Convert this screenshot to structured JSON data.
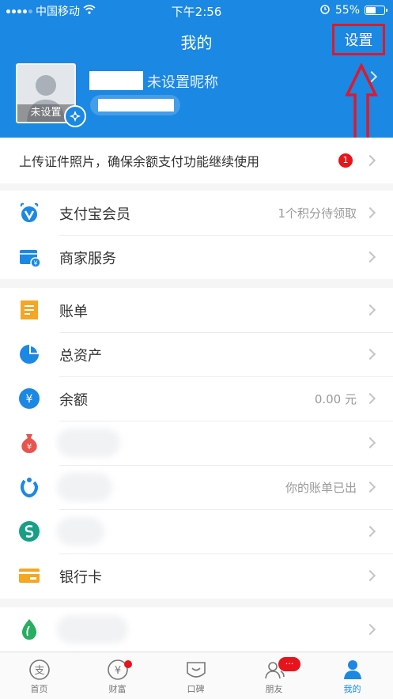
{
  "status_bar": {
    "carrier": "中国移动",
    "time": "下午2:56",
    "battery": "55%",
    "battery_level": 0.55
  },
  "header": {
    "title": "我的",
    "settings_label": "设置",
    "avatar_caption": "未设置",
    "nickname": "未设置昵称"
  },
  "notice": {
    "text": "上传证件照片，确保余额支付功能继续使用",
    "badge": "1"
  },
  "group1": [
    {
      "label": "支付宝会员",
      "value": "1个积分待领取",
      "icon": "member-icon"
    },
    {
      "label": "商家服务",
      "value": "",
      "icon": "merchant-icon"
    }
  ],
  "group2": [
    {
      "label": "账单",
      "value": "",
      "icon": "bill-icon"
    },
    {
      "label": "总资产",
      "value": "",
      "icon": "assets-pie-icon"
    },
    {
      "label": "余额",
      "value": "0.00 元",
      "icon": "yuan-icon"
    },
    {
      "label": "",
      "value": "",
      "icon": "money-bag-icon"
    },
    {
      "label": "",
      "value": "你的账单已出",
      "icon": "huabei-icon"
    },
    {
      "label": "",
      "value": "",
      "icon": "green-s-icon"
    },
    {
      "label": "银行卡",
      "value": "",
      "icon": "bank-card-icon"
    }
  ],
  "group3": [
    {
      "label": "",
      "value": "",
      "icon": "green-drop-icon"
    }
  ],
  "tabs": [
    {
      "label": "首页",
      "icon": "home-icon"
    },
    {
      "label": "财富",
      "icon": "wealth-icon"
    },
    {
      "label": "口碑",
      "icon": "koubei-icon"
    },
    {
      "label": "朋友",
      "icon": "friends-icon",
      "badge": "···"
    },
    {
      "label": "我的",
      "icon": "profile-icon"
    }
  ],
  "colors": {
    "brand_blue": "#1b88e3",
    "annotation_red": "#e0182a",
    "badge_red": "#e5141d"
  }
}
